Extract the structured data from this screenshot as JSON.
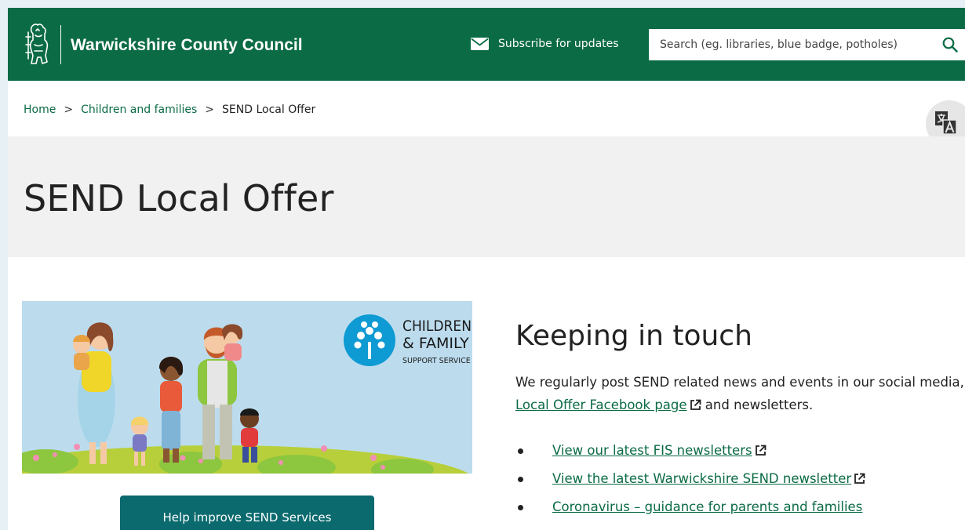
{
  "header": {
    "site_name": "Warwickshire County Council",
    "subscribe_label": "Subscribe for updates",
    "search_placeholder": "Search (eg. libraries, blue badge, potholes)",
    "icons": [
      "council-crest-icon",
      "envelope-icon",
      "search-icon"
    ]
  },
  "breadcrumb": {
    "items": [
      "Home",
      "Children and families",
      "SEND Local Offer"
    ],
    "separator": ">"
  },
  "translate_icon": "translate-icon",
  "page": {
    "title": "SEND Local Offer"
  },
  "banner": {
    "logo_line1": "CHILDREN",
    "logo_line2": "& FAMILY",
    "logo_line3": "SUPPORT SERVICE"
  },
  "cta": {
    "label": "Help improve SEND Services"
  },
  "keeping_in_touch": {
    "heading": "Keeping in touch",
    "para_start": "We regularly post SEND related news and events in our social media,",
    "para_link": "Local Offer Facebook page",
    "para_end": "and newsletters.",
    "links": [
      "View our latest FIS newsletters",
      "View the latest Warwickshire SEND newsletter",
      "Coronavirus – guidance for parents and families"
    ]
  },
  "colors": {
    "brand_green": "#0b6b45",
    "cta_teal": "#0b6a6e",
    "title_band": "#f1f1f1",
    "banner_sky": "#bcdcee"
  }
}
